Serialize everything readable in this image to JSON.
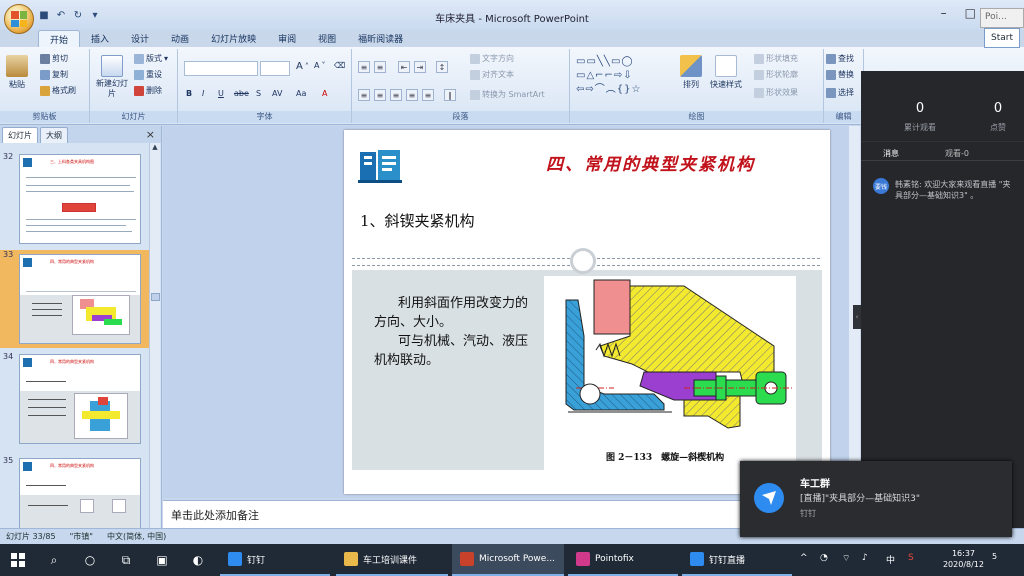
{
  "window": {
    "title": "车床夹具 - Microsoft PowerPoint",
    "other_app_tab": "Poi...",
    "start_button": "Start"
  },
  "ribbon_tabs": [
    "开始",
    "插入",
    "设计",
    "动画",
    "幻灯片放映",
    "审阅",
    "视图",
    "福昕阅读器"
  ],
  "ribbon": {
    "clipboard": {
      "paste": "粘贴",
      "cut": "剪切",
      "copy": "复制",
      "format_painter": "格式刷",
      "label": "剪贴板"
    },
    "slides": {
      "new_slide": "新建幻灯片",
      "layout": "版式",
      "reset": "重设",
      "delete": "删除",
      "label": "幻灯片"
    },
    "font": {
      "label": "字体",
      "bold": "B",
      "italic": "I",
      "underline": "U",
      "strike": "abe",
      "shadow": "S",
      "spacing": "AV",
      "case": "Aa",
      "color": "A",
      "grow": "A",
      "shrink": "A"
    },
    "paragraph": {
      "text_direction": "文字方向",
      "align_text": "对齐文本",
      "smartart": "转换为 SmartArt",
      "label": "段落"
    },
    "drawing": {
      "arrange": "排列",
      "quick_styles": "快速样式",
      "shape_fill": "形状填充",
      "shape_outline": "形状轮廓",
      "shape_effects": "形状效果",
      "label": "绘图"
    },
    "editing": {
      "find": "查找",
      "replace": "替换",
      "select": "选择",
      "label": "编辑"
    }
  },
  "left_pane": {
    "tabs": [
      "幻灯片",
      "大纲"
    ],
    "close": "×",
    "slides": [
      {
        "number": "32",
        "title": "三、上料各类夹具机构图"
      },
      {
        "number": "33",
        "title": "四、常用的典型夹紧机构"
      },
      {
        "number": "34",
        "title": "四、常用的典型夹紧机构"
      },
      {
        "number": "35",
        "title": "四、常用的典型夹紧机构"
      }
    ]
  },
  "slide": {
    "heading": "四、常用的典型夹紧机构",
    "subheading": "1、斜锲夹紧机构",
    "body_p1": "利用斜面作用改变力的方向、大小。",
    "body_p2": "可与机械、汽动、液压机构联动。",
    "caption": "图 2－133　螺旋—斜楔机构"
  },
  "notes_placeholder": "单击此处添加备注",
  "status_bar": {
    "slide_count": "幻灯片 33/85",
    "theme": "\"市镇\"",
    "language": "中文(简体, 中国)"
  },
  "live_panel": {
    "viewers_value": "0",
    "viewers_label": "累计观看",
    "likes_value": "0",
    "likes_label": "点赞",
    "tab_messages": "消息",
    "tab_views": "观看-0",
    "avatar_text": "要钱",
    "message": "韩素铭: 欢迎大家来观看直播 \"夹具部分—基础知识3\"  。"
  },
  "notification": {
    "title": "车工群",
    "line": "[直播]\"夹具部分—基础知识3\"",
    "app": "钉钉"
  },
  "taskbar": {
    "apps": [
      {
        "label": "钉钉",
        "color": "#2e8cf0"
      },
      {
        "label": "车工培训课件",
        "color": "#e8b84a"
      },
      {
        "label": "Microsoft Powe...",
        "color": "#c7412b"
      },
      {
        "label": "Pointofix",
        "color": "#d13a8a"
      },
      {
        "label": "钉钉直播",
        "color": "#2e8cf0"
      }
    ],
    "ime": "中",
    "time": "16:37",
    "date": "2020/8/12",
    "notifications_count": "5"
  },
  "colors": {
    "heading_red": "#c1121b",
    "figure_yellow": "#f3e92f",
    "figure_purple": "#9b3fd0",
    "figure_green": "#2bdc4e",
    "figure_blue": "#3aa0d8",
    "figure_pink": "#f08f8f"
  }
}
